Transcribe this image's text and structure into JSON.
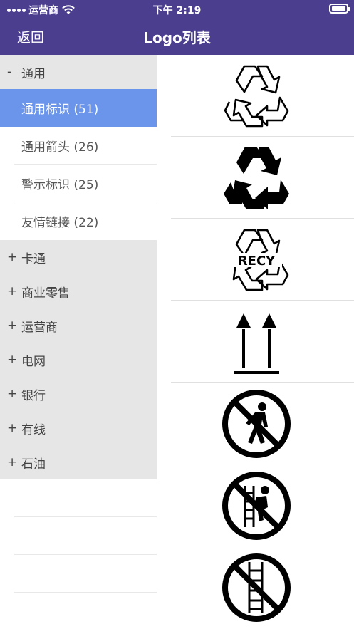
{
  "status_bar": {
    "carrier": "运营商",
    "time": "下午 2:19",
    "wifi_icon": "wifi-icon",
    "battery_icon": "battery-icon"
  },
  "nav": {
    "back_label": "返回",
    "title": "Logo列表"
  },
  "sidebar": {
    "expanded_group": {
      "sign": "-",
      "label": "通用"
    },
    "sub_items": [
      {
        "label": "通用标识 (51)",
        "active": true
      },
      {
        "label": "通用箭头 (26)",
        "active": false
      },
      {
        "label": "警示标识 (25)",
        "active": false
      },
      {
        "label": "友情链接 (22)",
        "active": false
      }
    ],
    "collapsed_groups": [
      {
        "sign": "+",
        "label": "卡通"
      },
      {
        "sign": "+",
        "label": "商业零售"
      },
      {
        "sign": "+",
        "label": "运营商"
      },
      {
        "sign": "+",
        "label": "电网"
      },
      {
        "sign": "+",
        "label": "银行"
      },
      {
        "sign": "+",
        "label": "有线"
      },
      {
        "sign": "+",
        "label": "石油"
      }
    ]
  },
  "logos": [
    {
      "icon": "recycle-outline-icon"
    },
    {
      "icon": "recycle-solid-icon"
    },
    {
      "icon": "recycle-text-icon",
      "text": "RECY"
    },
    {
      "icon": "this-way-up-icon"
    },
    {
      "icon": "no-pedestrian-icon"
    },
    {
      "icon": "no-climbing-ladder-icon"
    },
    {
      "icon": "no-ladder-icon"
    }
  ],
  "colors": {
    "header_bg": "#4b3e8f",
    "active_row_bg": "#6b95ea",
    "group_row_bg": "#e6e6e6"
  }
}
